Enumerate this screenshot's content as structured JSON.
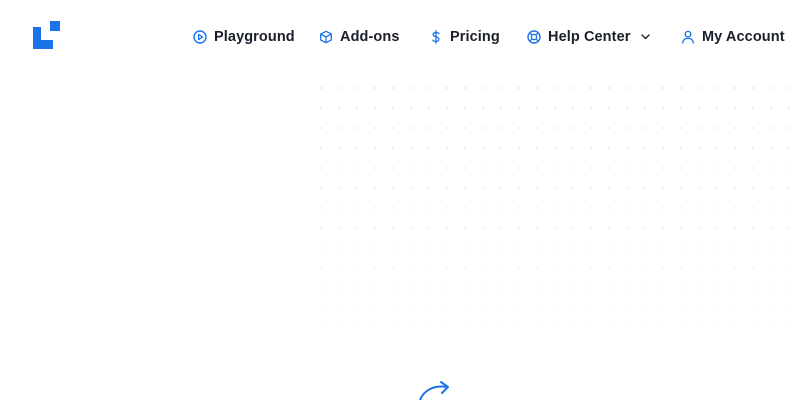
{
  "header": {
    "logo": {
      "icon": "brand-logo-icon",
      "color": "#1a73e8"
    },
    "nav": [
      {
        "label": "Playground",
        "icon": "play-circle-icon"
      },
      {
        "label": "Add-ons",
        "icon": "cube-icon"
      },
      {
        "label": "Pricing",
        "icon": "dollar-icon"
      },
      {
        "label": "Help Center",
        "icon": "lifebuoy-icon",
        "has_dropdown": true
      },
      {
        "label": "My Account",
        "icon": "user-icon"
      }
    ]
  },
  "colors": {
    "accent": "#1a73e8",
    "text": "#1b1e2b",
    "dot_grid": "#e8eaf1"
  },
  "decor": {
    "arrow_icon": "curved-arrow-icon"
  }
}
